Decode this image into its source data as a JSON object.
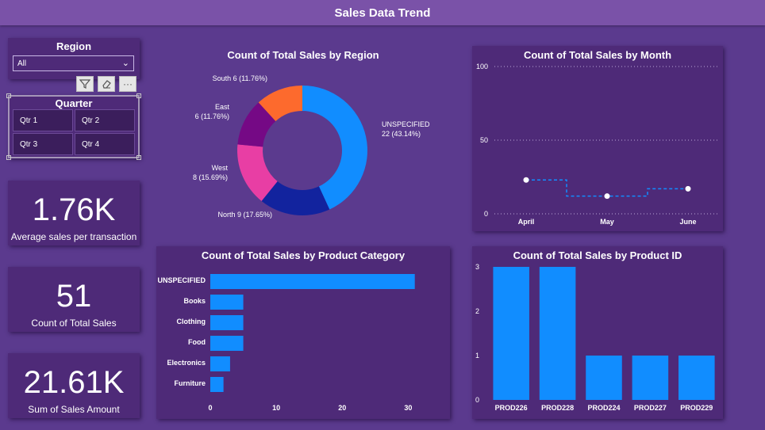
{
  "page": {
    "title": "Sales Data Trend"
  },
  "region_slicer": {
    "title": "Region",
    "selected": "All"
  },
  "toolbar": {
    "filter_icon": "filter-icon",
    "eraser_icon": "eraser-icon",
    "more_label": "···"
  },
  "quarter_slicer": {
    "title": "Quarter",
    "options": [
      "Qtr 1",
      "Qtr 2",
      "Qtr 3",
      "Qtr 4"
    ]
  },
  "cards": [
    {
      "value": "1.76K",
      "label": "Average sales per transaction"
    },
    {
      "value": "51",
      "label": "Count of Total Sales"
    },
    {
      "value": "21.61K",
      "label": "Sum of Sales Amount"
    }
  ],
  "chart_data": [
    {
      "type": "pie",
      "title": "Count of Total Sales by Region",
      "slices": [
        {
          "name": "UNSPECIFIED",
          "value": 22,
          "pct": "43.14%",
          "color": "#118dff"
        },
        {
          "name": "North",
          "value": 9,
          "pct": "17.65%",
          "color": "#12239e"
        },
        {
          "name": "West",
          "value": 8,
          "pct": "15.69%",
          "color": "#e83ea4"
        },
        {
          "name": "East",
          "value": 6,
          "pct": "11.76%",
          "color": "#750985"
        },
        {
          "name": "South",
          "value": 6,
          "pct": "11.76%",
          "color": "#fd6a2d"
        }
      ]
    },
    {
      "type": "line",
      "title": "Count of Total Sales by Month",
      "categories": [
        "April",
        "May",
        "June"
      ],
      "values": [
        23,
        12,
        17
      ],
      "ylim": [
        0,
        100
      ],
      "yticks": [
        "100",
        "50",
        "0"
      ],
      "grid": true,
      "color": "#118dff"
    },
    {
      "type": "bar",
      "orientation": "horizontal",
      "title": "Count of Total Sales by Product Category",
      "categories": [
        "UNSPECIFIED",
        "Books",
        "Clothing",
        "Food",
        "Electronics",
        "Furniture"
      ],
      "values": [
        31,
        5,
        5,
        5,
        3,
        2
      ],
      "xlim": [
        0,
        32
      ],
      "xticks": [
        "0",
        "10",
        "20",
        "30"
      ],
      "color": "#118dff"
    },
    {
      "type": "bar",
      "title": "Count of Total Sales by Product ID",
      "categories": [
        "PROD226",
        "PROD228",
        "PROD224",
        "PROD227",
        "PROD229"
      ],
      "values": [
        3,
        3,
        1,
        1,
        1
      ],
      "ylim": [
        0,
        3
      ],
      "yticks": [
        "3",
        "2",
        "1",
        "0"
      ],
      "color": "#118dff"
    }
  ]
}
